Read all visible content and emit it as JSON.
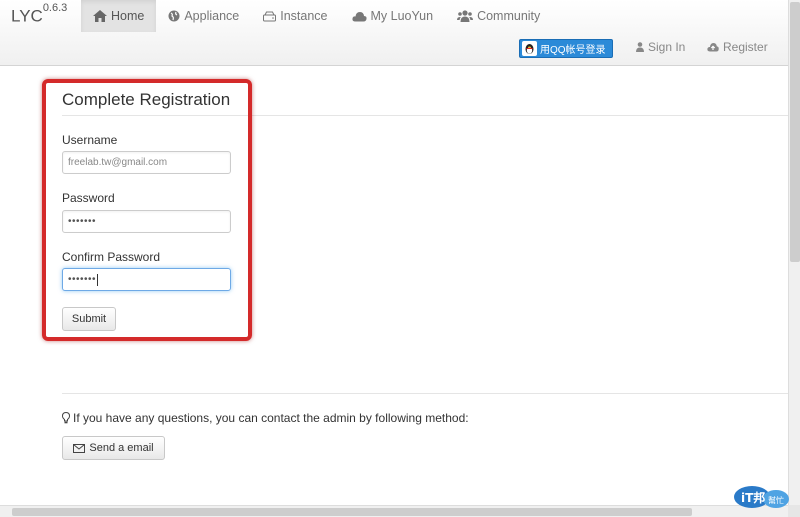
{
  "navbar": {
    "brand": "LYC",
    "version": "0.6.3",
    "items": [
      {
        "label": "Home",
        "icon": "home-icon"
      },
      {
        "label": "Appliance",
        "icon": "globe-icon"
      },
      {
        "label": "Instance",
        "icon": "hdd-icon"
      },
      {
        "label": "My LuoYun",
        "icon": "cloud-icon"
      },
      {
        "label": "Community",
        "icon": "users-icon"
      }
    ],
    "qq_login_label": "用QQ帐号登录",
    "signin_label": "Sign In",
    "register_label": "Register"
  },
  "form": {
    "title": "Complete Registration",
    "username_label": "Username",
    "username_value": "freelab.tw@gmail.com",
    "password_label": "Password",
    "password_value": "•••••••",
    "confirm_label": "Confirm Password",
    "confirm_value": "•••••••",
    "submit_label": "Submit"
  },
  "help": {
    "text": "If you have any questions, you can contact the admin by following method:",
    "email_button_label": "Send a email"
  },
  "watermark": {
    "text": "iT邦",
    "subtext": "幫忙"
  },
  "colors": {
    "highlight": "#d42a2a",
    "qq_button": "#2b8ad8",
    "focus": "#6ea9e6"
  }
}
